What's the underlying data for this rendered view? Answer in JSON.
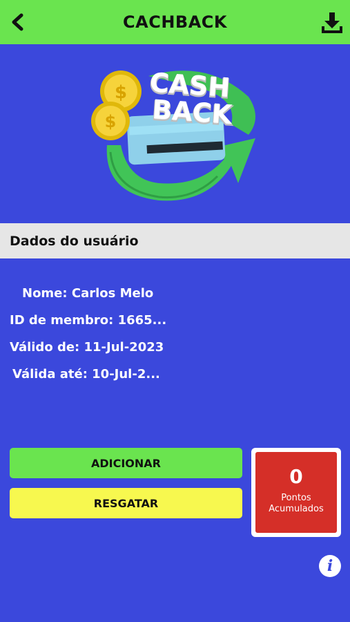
{
  "header": {
    "title": "CACHBACK",
    "back_icon": "back-arrow-icon",
    "download_icon": "download-icon"
  },
  "hero": {
    "badge_line1": "CASH",
    "badge_line2": "BACK"
  },
  "section": {
    "title": "Dados do usuário"
  },
  "user": {
    "name": "Nome: Carlos Melo",
    "member_id": "ID de membro: 1665...",
    "valid_from": "Válido de: 11-Jul-2023",
    "valid_until": "Válida até: 10-Jul-2..."
  },
  "actions": {
    "add_label": "ADICIONAR",
    "redeem_label": "RESGATAR"
  },
  "points": {
    "value": "0",
    "label_line1": "Pontos",
    "label_line2": "Acumulados"
  },
  "colors": {
    "background": "#3b48dc",
    "header": "#6ae44f",
    "add_button": "#6ae44f",
    "redeem_button": "#f7f84f",
    "points_box": "#d52f28"
  }
}
